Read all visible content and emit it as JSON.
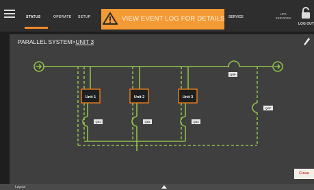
{
  "nav": {
    "tabs": [
      {
        "label": "STATUS"
      },
      {
        "label": "OPERATE"
      },
      {
        "label": "SETUP"
      }
    ],
    "alert": "VIEW EVENT LOG FOR DETAILS",
    "service": "SERVICE",
    "life_services_line1": "LIFE",
    "life_services_line2": "SERVICES",
    "logout": "LOG OUT"
  },
  "page": {
    "breadcrumb_root": "PARALLEL SYSTEM>",
    "breadcrumb_current": "UNIT 3"
  },
  "diagram": {
    "units": [
      "Unit 1",
      "Unit 2",
      "Unit 3"
    ],
    "breakers": {
      "qs1": "QS1",
      "qs2": "QS2",
      "qs3": "QS3",
      "qsp": "QSP",
      "qcf": "QCF"
    }
  },
  "buttons": {
    "close": "Close"
  },
  "bottom": {
    "label": "Layout"
  },
  "colors": {
    "accent": "#f39a34",
    "line": "#8fc14a",
    "unit_border": "#e07a1f",
    "background": "#3f3f3f"
  }
}
